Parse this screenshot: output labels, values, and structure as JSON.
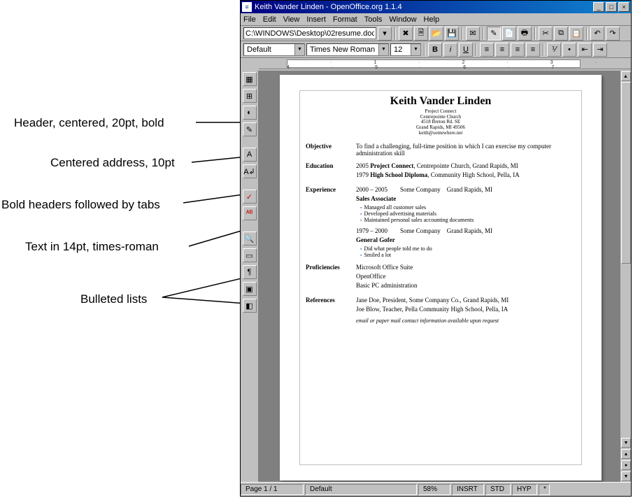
{
  "annotations": {
    "a1": "Header, centered, 20pt, bold",
    "a2": "Centered address, 10pt",
    "a3": "Bold headers followed by tabs",
    "a4": "Text in 14pt, times-roman",
    "a5": "Bulleted lists"
  },
  "titlebar": {
    "text": "Keith Vander Linden - OpenOffice.org 1.1.4"
  },
  "menu": {
    "file": "File",
    "edit": "Edit",
    "view": "View",
    "insert": "Insert",
    "format": "Format",
    "tools": "Tools",
    "window": "Window",
    "help": "Help"
  },
  "pathbar": {
    "path": "C:\\WINDOWS\\Desktop\\02resume.doc"
  },
  "formatbar": {
    "style": "Default",
    "font": "Times New Roman",
    "size": "12"
  },
  "resume": {
    "name": "Keith Vander Linden",
    "addr1": "Project Connect",
    "addr2": "Centrepointe Church",
    "addr3": "4518 Breton Rd. SE",
    "addr4": "Grand Rapids, MI 49506",
    "addr5": "keith@somewhere.net",
    "objective_label": "Objective",
    "objective_text": "To find a challenging, full-time position in which I can exercise my computer administration skill",
    "education_label": "Education",
    "edu1_year": "2005",
    "edu1_deg": "Project Connect",
    "edu1_rest": ", Centrepointe Church, Grand Rapids, MI",
    "edu2_year": "1979",
    "edu2_deg": "High School Diploma",
    "edu2_rest": ", Community High School, Pella, IA",
    "experience_label": "Experience",
    "exp1_dates": "2000 – 2005",
    "exp1_company": "Some Company",
    "exp1_loc": "Grand Rapids, MI",
    "exp1_title": "Sales Associate",
    "exp1_b1": "Managed all customer sales",
    "exp1_b2": "Developed advertising materials",
    "exp1_b3": "Maintained personal sales accounting documents",
    "exp2_dates": "1979 – 2000",
    "exp2_company": "Some Company",
    "exp2_loc": "Grand Rapids, MI",
    "exp2_title": "General Gofer",
    "exp2_b1": "Did what people told me to do",
    "exp2_b2": "Smiled a lot",
    "prof_label": "Proficiencies",
    "prof1": "Microsoft Office Suite",
    "prof2": "OpenOffice",
    "prof3": "Basic PC administration",
    "ref_label": "References",
    "ref1": "Jane Doe, President, Some Company Co., Grand Rapids, MI",
    "ref2": "Joe Blow, Teacher, Pella Community High School, Pella, IA",
    "ref_note": "email or paper mail contact information available upon request"
  },
  "statusbar": {
    "page": "Page 1 / 1",
    "style": "Default",
    "zoom": "58%",
    "insrt": "INSRT",
    "std": "STD",
    "hyp": "HYP",
    "star": "*"
  },
  "icons": {
    "min": "_",
    "max": "□",
    "close": "×",
    "dd": "▼"
  }
}
